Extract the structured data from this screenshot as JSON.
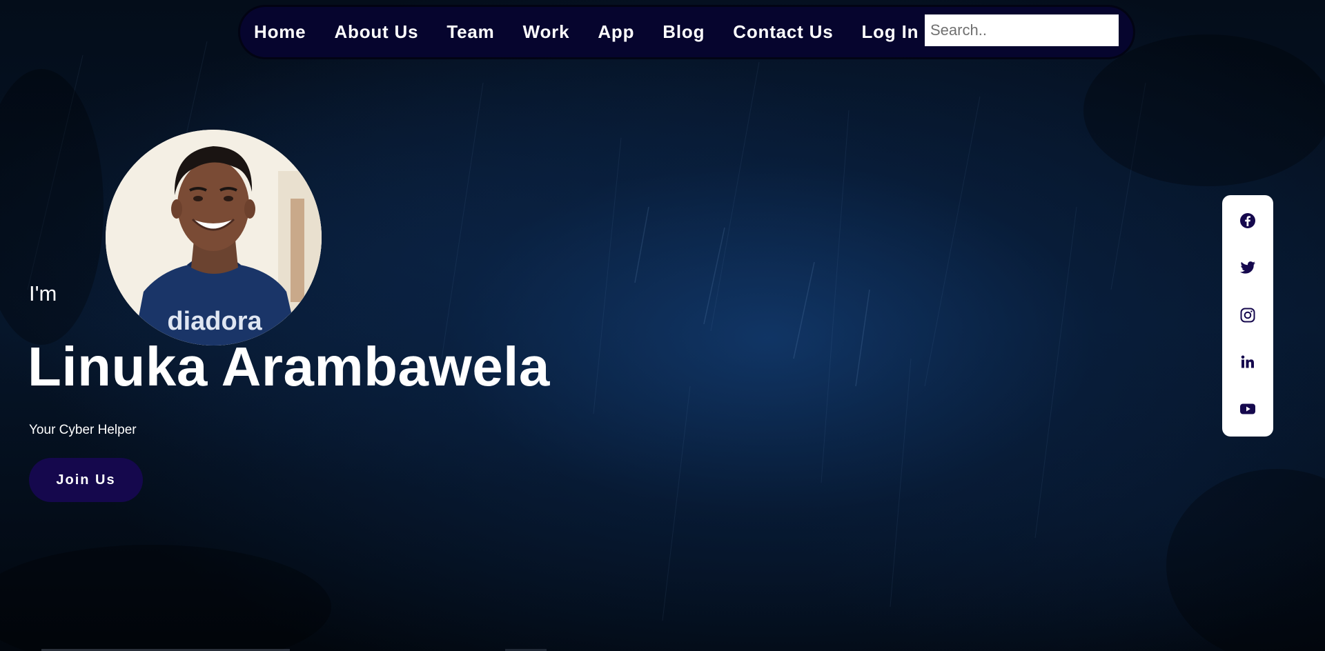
{
  "nav": {
    "items": [
      {
        "label": "Home"
      },
      {
        "label": "About Us"
      },
      {
        "label": "Team"
      },
      {
        "label": "Work"
      },
      {
        "label": "App"
      },
      {
        "label": "Blog"
      },
      {
        "label": "Contact Us"
      },
      {
        "label": "Log In"
      }
    ],
    "search_placeholder": "Search.."
  },
  "hero": {
    "intro": "I'm",
    "name": "Linuka Arambawela",
    "tagline": "Your Cyber Helper",
    "join_label": "Join Us",
    "shirt_text": "diadora"
  },
  "social": {
    "icons": [
      "facebook-icon",
      "twitter-icon",
      "instagram-icon",
      "linkedin-icon",
      "youtube-icon"
    ],
    "color": "#15084d"
  },
  "colors": {
    "nav_background": "#06052e",
    "button_background": "#15084d",
    "text": "#ffffff"
  }
}
